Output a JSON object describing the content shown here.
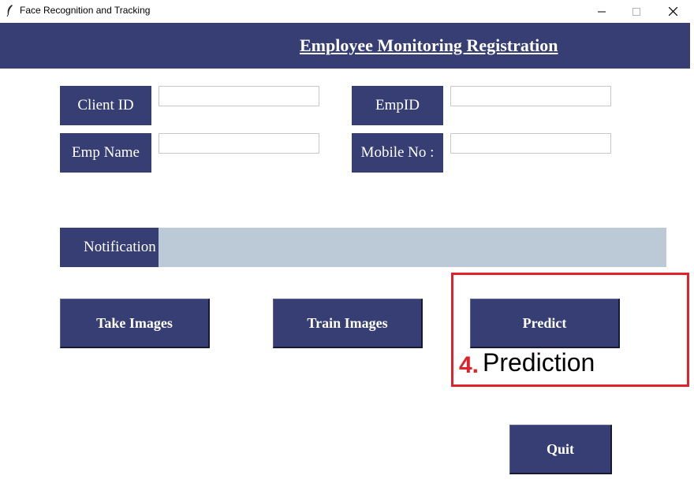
{
  "window": {
    "title": "Face Recognition and Tracking",
    "icon": "feather-icon",
    "controls": [
      "minimize-icon",
      "maximize-icon",
      "close-icon"
    ]
  },
  "header": {
    "title": "Employee Monitoring Registration"
  },
  "form": {
    "client_id": {
      "label": "Client ID",
      "value": ""
    },
    "emp_id": {
      "label": "EmpID",
      "value": ""
    },
    "emp_name": {
      "label": "Emp Name",
      "value": ""
    },
    "mobile_no": {
      "label": "Mobile No :",
      "value": ""
    }
  },
  "notification": {
    "label": "Notification",
    "message": ""
  },
  "buttons": {
    "take_images": "Take Images",
    "train_images": "Train Images",
    "predict": "Predict",
    "quit": "Quit"
  },
  "annotation": {
    "number": "4.",
    "text": "Prediction"
  },
  "colors": {
    "primary": "#363e73",
    "notification_bar": "#bcc9d6",
    "annotation": "#e0232b"
  }
}
